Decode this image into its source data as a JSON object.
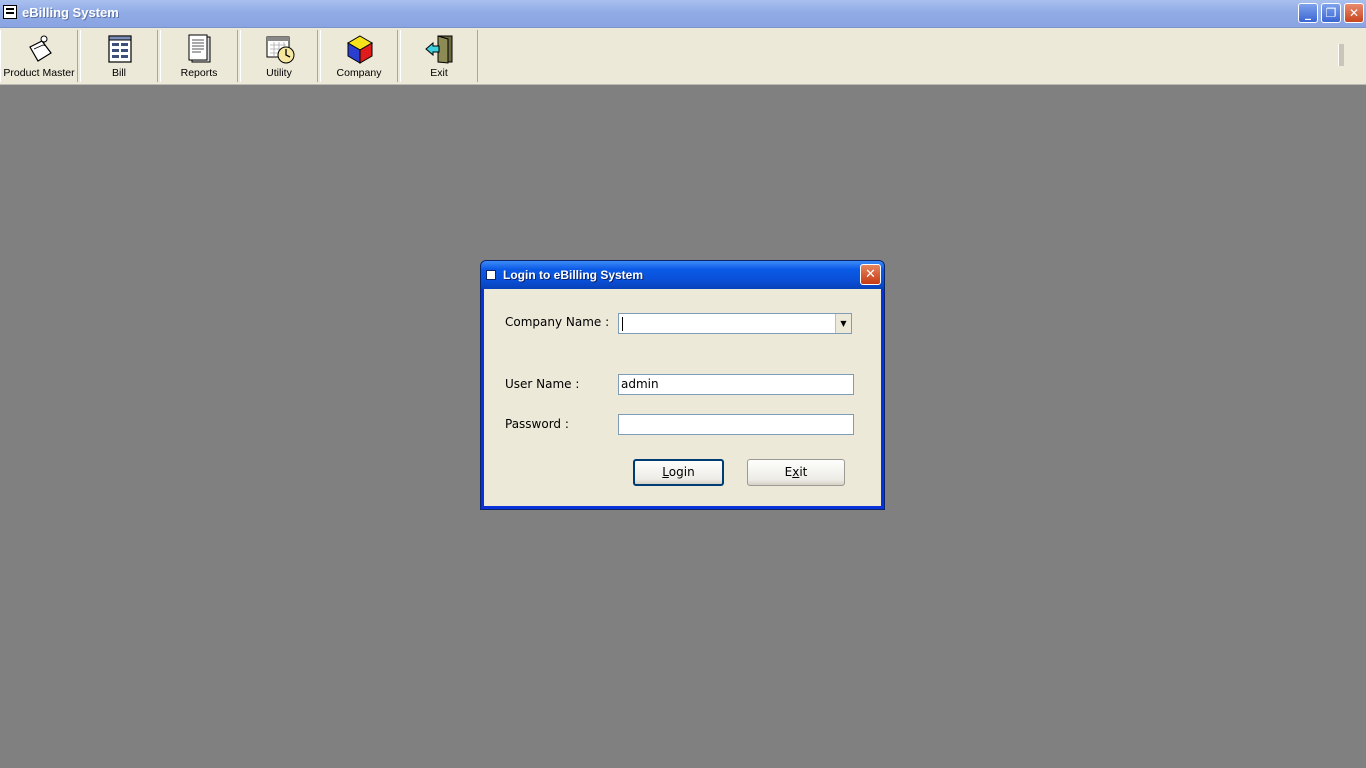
{
  "window": {
    "title": "eBilling System",
    "controls": {
      "minimize": "_",
      "restore": "❐",
      "close": "✕"
    }
  },
  "toolbar": {
    "items": [
      {
        "label": "Product Master",
        "icon": "product-master-icon"
      },
      {
        "label": "Bill",
        "icon": "bill-icon"
      },
      {
        "label": "Reports",
        "icon": "reports-icon"
      },
      {
        "label": "Utility",
        "icon": "utility-icon"
      },
      {
        "label": "Company",
        "icon": "company-icon"
      },
      {
        "label": "Exit",
        "icon": "exit-door-icon"
      }
    ]
  },
  "login_dialog": {
    "title": "Login to eBilling System",
    "company_label": "Company Name :",
    "company_value": "",
    "user_label": "User Name :",
    "user_value": "admin",
    "password_label": "Password :",
    "password_value": "",
    "login_button": {
      "first": "L",
      "rest": "ogin"
    },
    "exit_button": {
      "first": "E",
      "accel": "x",
      "rest": "it"
    }
  },
  "colors": {
    "workspace": "#808080",
    "title_bar": "#91abe6",
    "dialog_title_bar": "#0a5ae6",
    "dialog_body": "#ece9d8"
  }
}
